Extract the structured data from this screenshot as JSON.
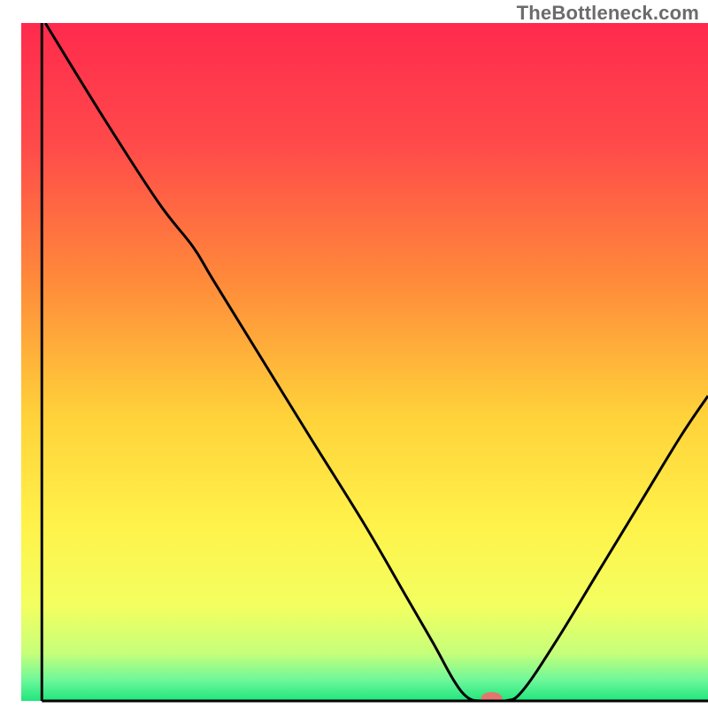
{
  "watermark": "TheBottleneck.com",
  "chart_data": {
    "type": "line",
    "title": "",
    "xlabel": "",
    "ylabel": "",
    "xlim": [
      0,
      100
    ],
    "ylim": [
      0,
      100
    ],
    "gradient_stops": [
      {
        "offset": 0.0,
        "color": "#ff2a4d"
      },
      {
        "offset": 0.18,
        "color": "#ff4a4a"
      },
      {
        "offset": 0.38,
        "color": "#ff8a3a"
      },
      {
        "offset": 0.58,
        "color": "#ffd23a"
      },
      {
        "offset": 0.74,
        "color": "#fff24a"
      },
      {
        "offset": 0.86,
        "color": "#f3ff60"
      },
      {
        "offset": 0.93,
        "color": "#c6ff7a"
      },
      {
        "offset": 0.97,
        "color": "#6cf79a"
      },
      {
        "offset": 1.0,
        "color": "#1FE67C"
      }
    ],
    "series": [
      {
        "name": "bottleneck-curve",
        "color": "#000000",
        "points": [
          {
            "x": 3.5,
            "y": 100.0
          },
          {
            "x": 12.0,
            "y": 86.0
          },
          {
            "x": 20.0,
            "y": 73.5
          },
          {
            "x": 25.0,
            "y": 67.0
          },
          {
            "x": 28.0,
            "y": 62.0
          },
          {
            "x": 35.0,
            "y": 50.5
          },
          {
            "x": 42.0,
            "y": 39.0
          },
          {
            "x": 50.0,
            "y": 26.0
          },
          {
            "x": 56.0,
            "y": 15.5
          },
          {
            "x": 60.0,
            "y": 8.5
          },
          {
            "x": 63.0,
            "y": 3.0
          },
          {
            "x": 65.0,
            "y": 0.5
          },
          {
            "x": 67.0,
            "y": 0.0
          },
          {
            "x": 70.5,
            "y": 0.0
          },
          {
            "x": 73.0,
            "y": 1.5
          },
          {
            "x": 78.0,
            "y": 9.0
          },
          {
            "x": 84.0,
            "y": 19.0
          },
          {
            "x": 90.0,
            "y": 29.0
          },
          {
            "x": 96.0,
            "y": 39.0
          },
          {
            "x": 100.0,
            "y": 45.0
          }
        ]
      }
    ],
    "marker": {
      "name": "optimal-point",
      "x": 68.5,
      "y": 0.0,
      "color": "#E2766E",
      "rx": 12,
      "ry": 7
    },
    "axes": {
      "left": {
        "x": 3.0,
        "y1": 0,
        "y2": 100
      },
      "bottom": {
        "y": 0.0,
        "x1": 3,
        "x2": 100
      }
    }
  }
}
